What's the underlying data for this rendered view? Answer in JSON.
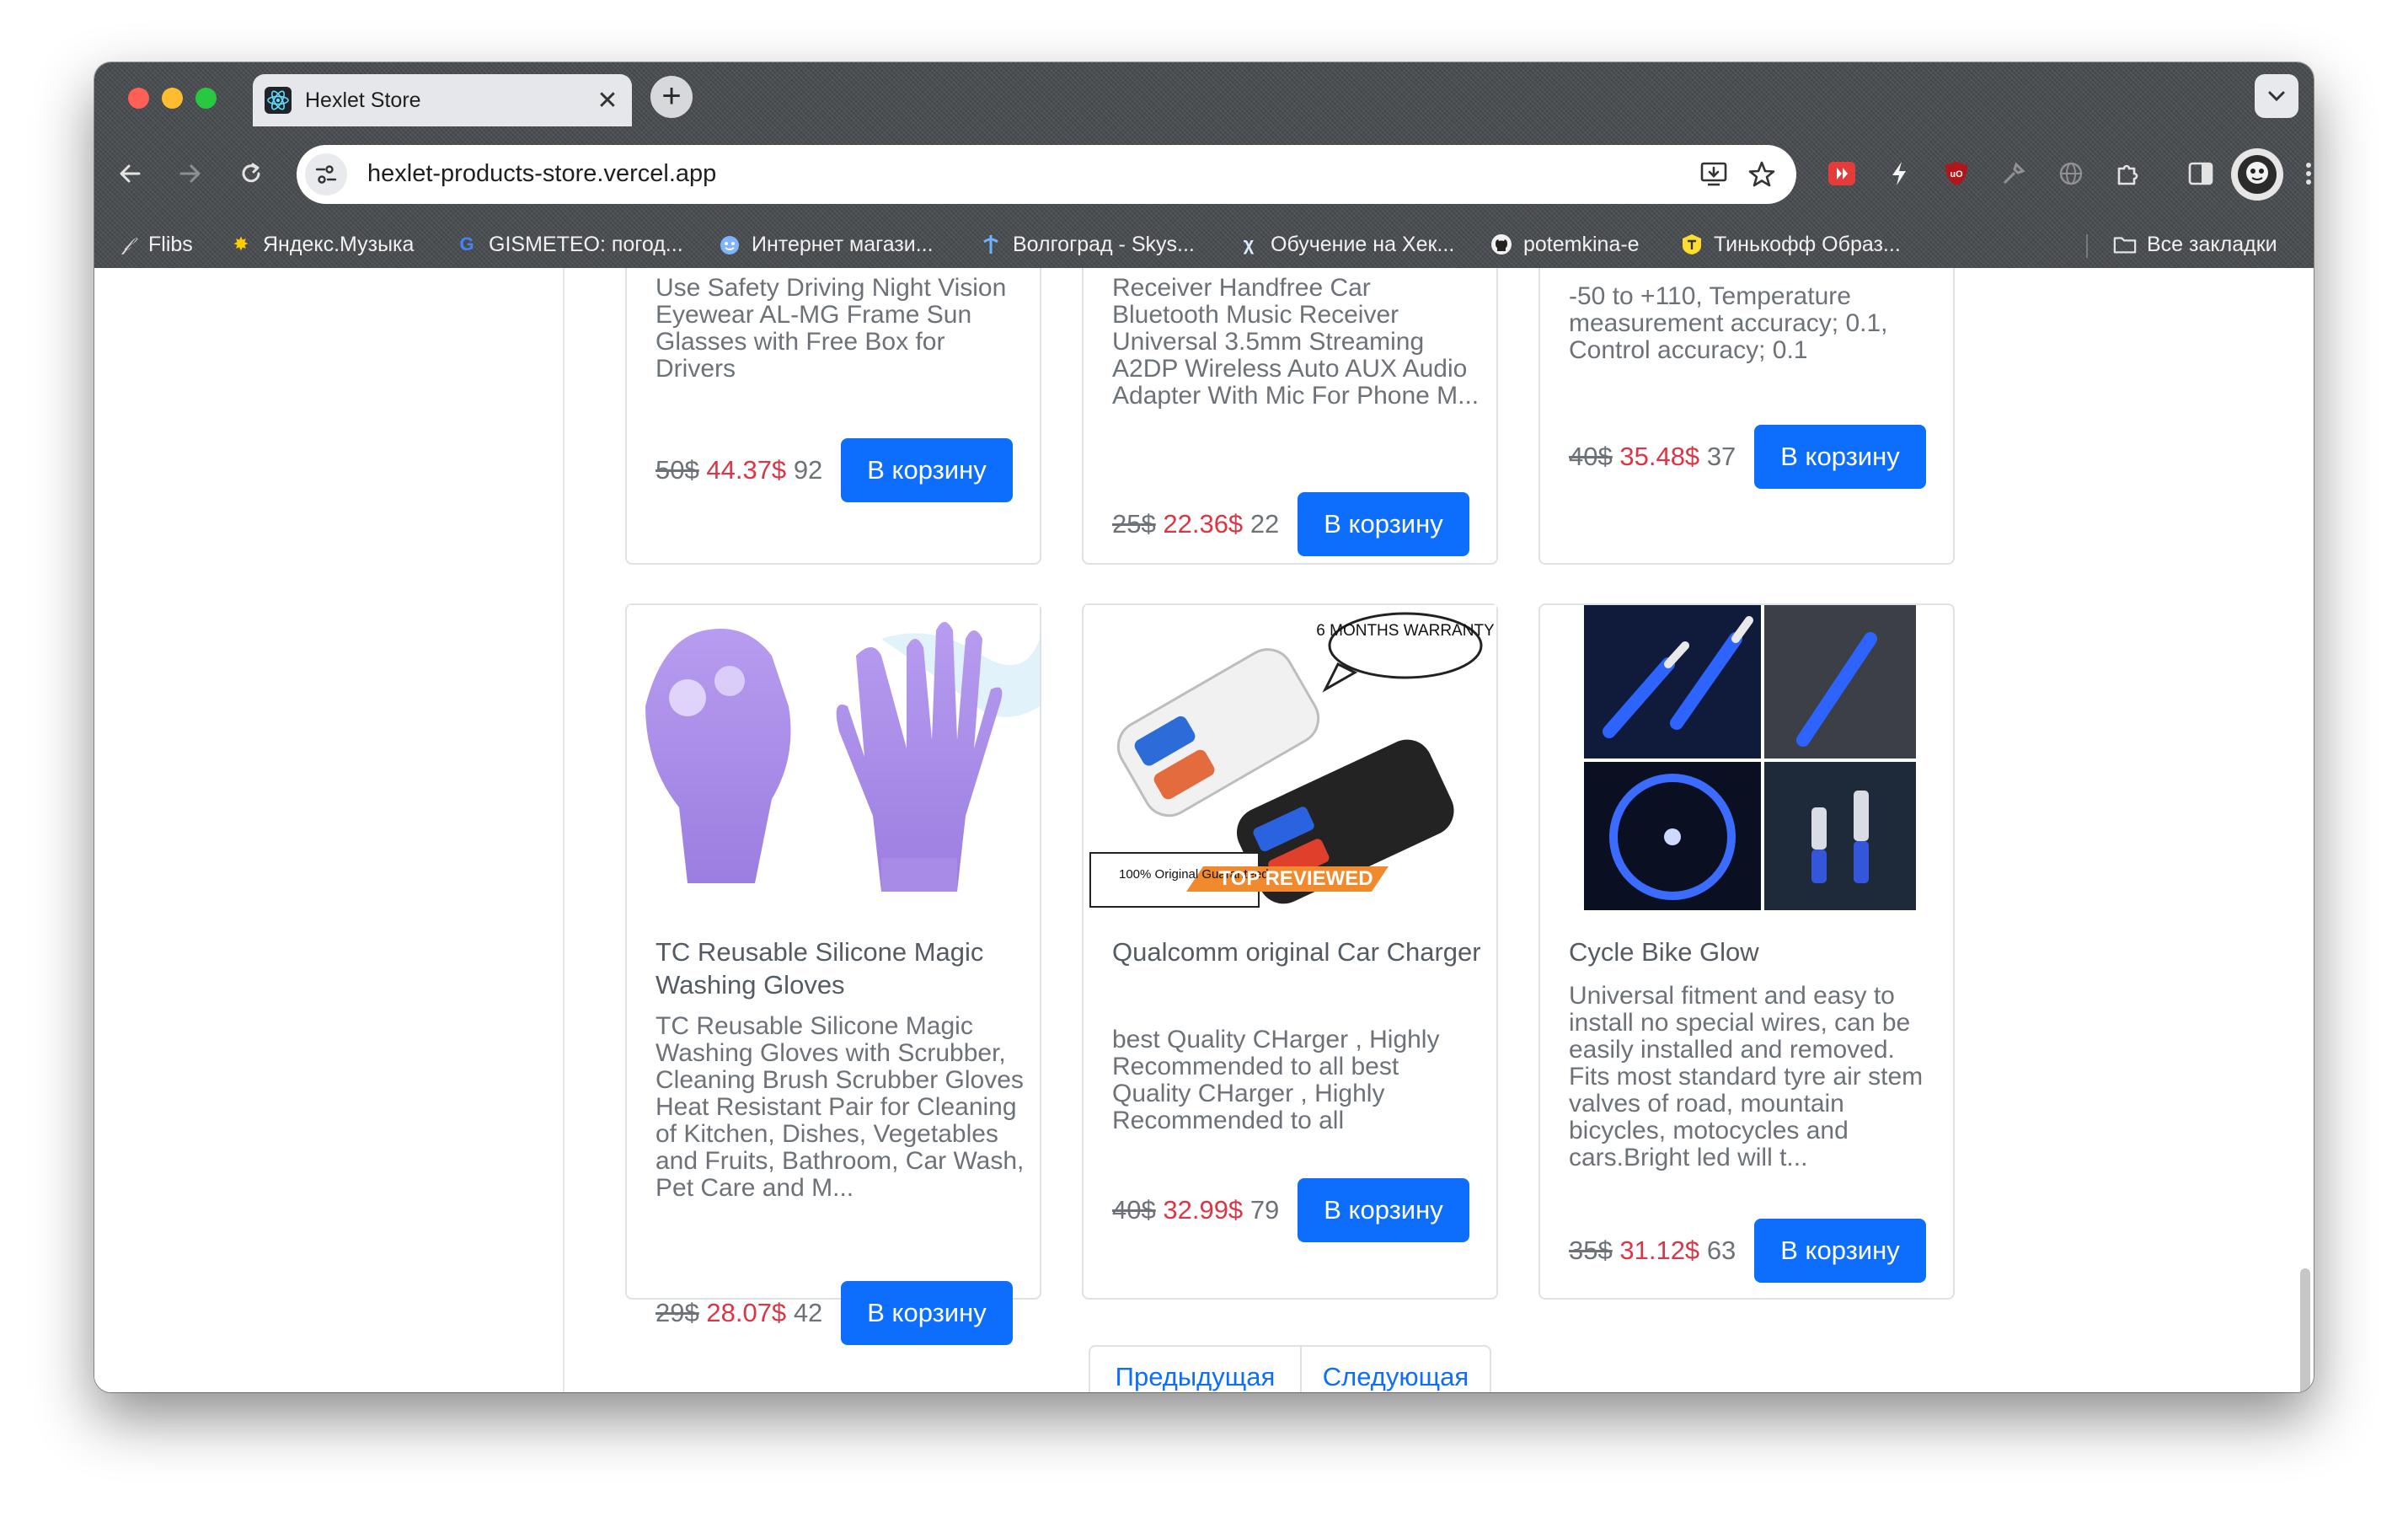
{
  "browser": {
    "tab": {
      "title": "Hexlet Store"
    },
    "url": "hexlet-products-store.vercel.app",
    "bookmarks": [
      {
        "label": "Flibs",
        "icon": "flibs-icon"
      },
      {
        "label": "Яндекс.Музыка",
        "icon": "yandex-music-icon"
      },
      {
        "label": "GISMETEO: погод...",
        "icon": "google-icon"
      },
      {
        "label": "Интернет магази...",
        "icon": "shop-icon"
      },
      {
        "label": "Волгоград - Skys...",
        "icon": "skyscanner-icon"
      },
      {
        "label": "Обучение на Хек...",
        "icon": "hexlet-icon"
      },
      {
        "label": "potemkina-e",
        "icon": "github-icon"
      },
      {
        "label": "Тинькофф Образ...",
        "icon": "tinkoff-icon"
      }
    ],
    "all_bookmarks": "Все закладки"
  },
  "products_top": [
    {
      "desc": "Use Safety Driving Night Vision Eyewear AL-MG Frame Sun Glasses with Free Box for Drivers",
      "old_price": "50$",
      "new_price": "44.37$",
      "stock": "92",
      "cart": "В корзину"
    },
    {
      "desc": "Receiver Handfree Car Bluetooth Music Receiver Universal 3.5mm Streaming A2DP Wireless Auto AUX Audio Adapter With Mic For Phone M...",
      "old_price": "25$",
      "new_price": "22.36$",
      "stock": "22",
      "cart": "В корзину"
    },
    {
      "desc": "-50 to +110, Temperature measurement accuracy; 0.1, Control accuracy; 0.1",
      "old_price": "40$",
      "new_price": "35.48$",
      "stock": "37",
      "cart": "В корзину"
    }
  ],
  "products": [
    {
      "title": "TC Reusable Silicone Magic Washing Gloves",
      "desc": "TC Reusable Silicone Magic Washing Gloves with Scrubber, Cleaning Brush Scrubber Gloves Heat Resistant Pair for Cleaning of Kitchen, Dishes, Vegetables and Fruits, Bathroom, Car Wash, Pet Care and M...",
      "old_price": "29$",
      "new_price": "28.07$",
      "stock": "42",
      "cart": "В корзину"
    },
    {
      "title": "Qualcomm original Car Charger",
      "desc": "best Quality CHarger , Highly Recommended to all best Quality CHarger , Highly Recommended to all",
      "old_price": "40$",
      "new_price": "32.99$",
      "stock": "79",
      "cart": "В корзину",
      "image_text": {
        "warranty": "6 MONTHS WARRANTY",
        "guarantee": "100% Original Guaranteed",
        "badge": "TOP REVIEWED"
      }
    },
    {
      "title": "Cycle Bike Glow",
      "desc": "Universal fitment and easy to install no special wires, can be easily installed and removed. Fits most standard tyre air stem valves of road, mountain bicycles, motocycles and cars.Bright led will t...",
      "old_price": "35$",
      "new_price": "31.12$",
      "stock": "63",
      "cart": "В корзину"
    }
  ],
  "pagination": {
    "prev": "Предыдущая",
    "next": "Следующая"
  }
}
